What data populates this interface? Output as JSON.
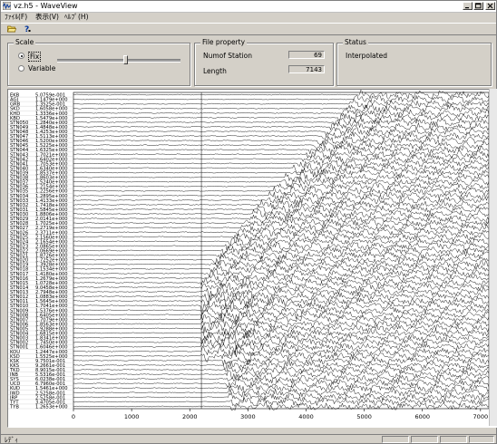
{
  "window": {
    "title": "vz.h5 - WaveView"
  },
  "menu": {
    "items": [
      {
        "name": "file",
        "label": "ﾌｧｲﾙ(F)"
      },
      {
        "name": "view",
        "label": "表示(V)"
      },
      {
        "name": "help",
        "label": "ﾍﾙﾌﾟ(H)"
      }
    ]
  },
  "toolbar": {
    "icons": [
      "open-folder-icon",
      "help-icon"
    ]
  },
  "scale": {
    "legend": "Scale",
    "fix_label": "Fix",
    "variable_label": "Variable",
    "selected": "Fix",
    "slider_position": 0.55
  },
  "file_property": {
    "legend": "File property",
    "station_label": "Numof Station",
    "station_value": "69",
    "length_label": "Length",
    "length_value": "7143"
  },
  "status": {
    "legend": "Status",
    "value": "Interpolated"
  },
  "statusbar": {
    "text": "ﾚﾃﾞｨ"
  },
  "chart_data": {
    "type": "line",
    "xlim": [
      0,
      7143
    ],
    "x_ticks": [
      "0",
      "1000",
      "2000",
      "3000",
      "4000",
      "5000",
      "6000",
      "7000"
    ],
    "marker_x": 2200,
    "trace_count": 69,
    "trace_labels": [
      {
        "name": "EKB",
        "scale": "5.0759e-001"
      },
      {
        "name": "AGJ",
        "scale": "1.1479e+000"
      },
      {
        "name": "GRB",
        "scale": "1.3525e-001"
      },
      {
        "name": "SKD",
        "scale": "1.6058e+000"
      },
      {
        "name": "KHD",
        "scale": "1.3336e+000"
      },
      {
        "name": "KBD",
        "scale": "1.5479e+000"
      },
      {
        "name": "STN050",
        "scale": "1.2840e+000"
      },
      {
        "name": "STN049",
        "scale": "1.4848e+000"
      },
      {
        "name": "STN048",
        "scale": "1.4253e+000"
      },
      {
        "name": "STN047",
        "scale": "1.5113e+000"
      },
      {
        "name": "STN046",
        "scale": "1.5200e+000"
      },
      {
        "name": "STN045",
        "scale": "1.5225e+000"
      },
      {
        "name": "STN044",
        "scale": "1.6325e+000"
      },
      {
        "name": "STN043",
        "scale": "1.7021e+000"
      },
      {
        "name": "STN042",
        "scale": "1.6402e+000"
      },
      {
        "name": "STN041",
        "scale": "1.7053e+000"
      },
      {
        "name": "STN040",
        "scale": "1.6340e+000"
      },
      {
        "name": "STN039",
        "scale": "1.8537e+000"
      },
      {
        "name": "STN038",
        "scale": "1.8603e+000"
      },
      {
        "name": "STN037",
        "scale": "1.5240e+000"
      },
      {
        "name": "STN036",
        "scale": "1.2154e+000"
      },
      {
        "name": "STN035",
        "scale": "1.2256e+000"
      },
      {
        "name": "STN034",
        "scale": "1.2895e+000"
      },
      {
        "name": "STN033",
        "scale": "1.4133e+000"
      },
      {
        "name": "STN032",
        "scale": "1.7418e+000"
      },
      {
        "name": "STN031",
        "scale": "1.5845e+000"
      },
      {
        "name": "STN030",
        "scale": "1.8806e+000"
      },
      {
        "name": "STN029",
        "scale": "2.0141e+000"
      },
      {
        "name": "STN028",
        "scale": "1.7025e+000"
      },
      {
        "name": "STN027",
        "scale": "2.2719e+000"
      },
      {
        "name": "STN026",
        "scale": "2.3711e+000"
      },
      {
        "name": "STN025",
        "scale": "2.1560e+000"
      },
      {
        "name": "STN024",
        "scale": "2.1654e+000"
      },
      {
        "name": "STN023",
        "scale": "2.0865e+000"
      },
      {
        "name": "STN022",
        "scale": "2.0669e+000"
      },
      {
        "name": "STN021",
        "scale": "1.8726e+000"
      },
      {
        "name": "STN020",
        "scale": "1.7252e+000"
      },
      {
        "name": "STN019",
        "scale": "1.3928e+000"
      },
      {
        "name": "STN018",
        "scale": "1.1534e+000"
      },
      {
        "name": "STN017",
        "scale": "1.4180e+000"
      },
      {
        "name": "STN016",
        "scale": "1.2679e+000"
      },
      {
        "name": "STN015",
        "scale": "1.0728e+000"
      },
      {
        "name": "STN014",
        "scale": "9.0458e+000"
      },
      {
        "name": "STN013",
        "scale": "2.7948e+000"
      },
      {
        "name": "STN012",
        "scale": "1.0883e+000"
      },
      {
        "name": "STN011",
        "scale": "1.5645e+000"
      },
      {
        "name": "STN010",
        "scale": "1.7041e+000"
      },
      {
        "name": "STN009",
        "scale": "1.5376e+000"
      },
      {
        "name": "STN008",
        "scale": "1.6405e+000"
      },
      {
        "name": "STN007",
        "scale": "1.7079e+000"
      },
      {
        "name": "STN006",
        "scale": "1.8563e+000"
      },
      {
        "name": "STN005",
        "scale": "1.9288e+000"
      },
      {
        "name": "STN004",
        "scale": "1.6815e+000"
      },
      {
        "name": "STN003",
        "scale": "1.8341e+000"
      },
      {
        "name": "STN002",
        "scale": "1.7450e+000"
      },
      {
        "name": "STN001",
        "scale": "1.6046e+000"
      },
      {
        "name": "KOU",
        "scale": "1.2447e+000"
      },
      {
        "name": "KSD",
        "scale": "1.5525e+000"
      },
      {
        "name": "KSK",
        "scale": "9.7501e-001"
      },
      {
        "name": "KKS",
        "scale": "9.2661e-001"
      },
      {
        "name": "TKD",
        "scale": "8.9015e-001"
      },
      {
        "name": "INB",
        "scale": "5.5316e-001"
      },
      {
        "name": "SYS",
        "scale": "6.0238e-001"
      },
      {
        "name": "UCD",
        "scale": "6.7960e-001"
      },
      {
        "name": "KUD",
        "scale": "1.5461e+000"
      },
      {
        "name": "IWD",
        "scale": "2.5258e-001"
      },
      {
        "name": "IRP",
        "scale": "2.5258e-001"
      },
      {
        "name": "TYT",
        "scale": "3.4705e-001"
      },
      {
        "name": "TYB",
        "scale": "1.2653e+000"
      }
    ]
  }
}
